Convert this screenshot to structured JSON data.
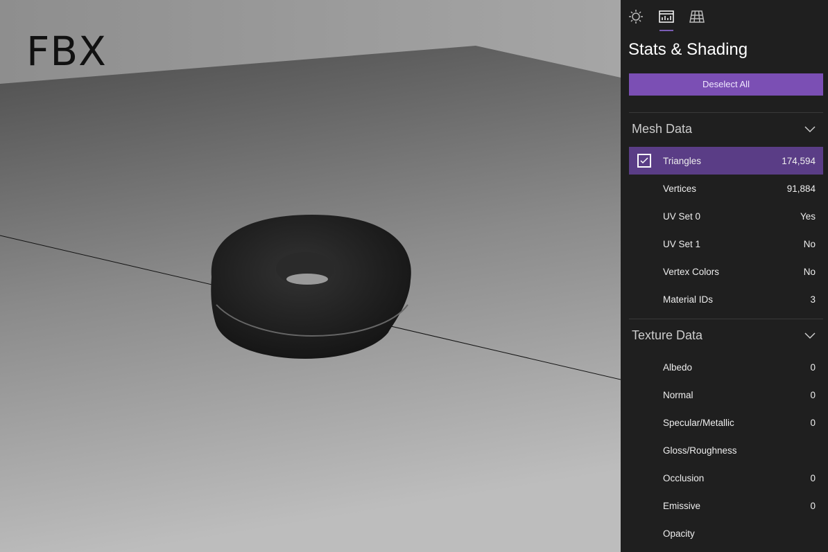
{
  "viewport": {
    "format_label": "FBX"
  },
  "panel": {
    "tabs": [
      {
        "name": "lighting",
        "icon": "sun-icon"
      },
      {
        "name": "stats",
        "icon": "stats-icon",
        "active": true
      },
      {
        "name": "grid",
        "icon": "grid-icon"
      }
    ],
    "title": "Stats & Shading",
    "deselect_label": "Deselect All",
    "mesh": {
      "header": "Mesh Data",
      "rows": [
        {
          "label": "Triangles",
          "value": "174,594",
          "selected": true
        },
        {
          "label": "Vertices",
          "value": "91,884"
        },
        {
          "label": "UV Set 0",
          "value": "Yes"
        },
        {
          "label": "UV Set 1",
          "value": "No"
        },
        {
          "label": "Vertex Colors",
          "value": "No"
        },
        {
          "label": "Material IDs",
          "value": "3"
        }
      ]
    },
    "texture": {
      "header": "Texture Data",
      "rows": [
        {
          "label": "Albedo",
          "value": "0"
        },
        {
          "label": "Normal",
          "value": "0"
        },
        {
          "label": "Specular/Metallic",
          "value": "0"
        },
        {
          "label": "Gloss/Roughness",
          "value": ""
        },
        {
          "label": "Occlusion",
          "value": "0"
        },
        {
          "label": "Emissive",
          "value": "0"
        },
        {
          "label": "Opacity",
          "value": ""
        }
      ]
    }
  },
  "colors": {
    "accent": "#7b4fb4",
    "selected_row": "#5a3d86",
    "panel_bg": "#1f1f1f"
  }
}
